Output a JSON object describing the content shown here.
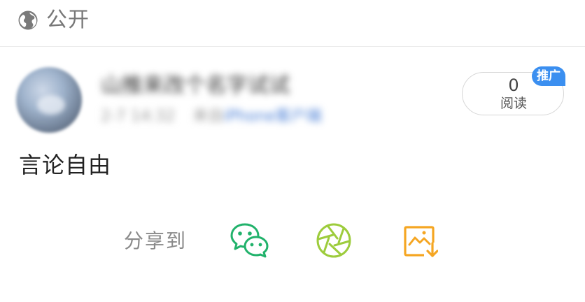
{
  "header": {
    "visibility_icon": "globe-icon",
    "visibility_label": "公开"
  },
  "post": {
    "author_name": "山推来改个名字试试",
    "time": "2-7 14:32",
    "source_prefix": "来自",
    "source": "iPhone客户端",
    "content": "言论自由"
  },
  "stats": {
    "read_count": "0",
    "read_label": "阅读",
    "badge": "推广"
  },
  "share": {
    "label": "分享到",
    "targets": [
      {
        "name": "wechat",
        "icon": "wechat-icon",
        "color": "#21b26b"
      },
      {
        "name": "moments",
        "icon": "moments-icon",
        "color": "#9dcc3c"
      },
      {
        "name": "save-image",
        "icon": "save-image-icon",
        "color": "#f5a623"
      }
    ]
  }
}
